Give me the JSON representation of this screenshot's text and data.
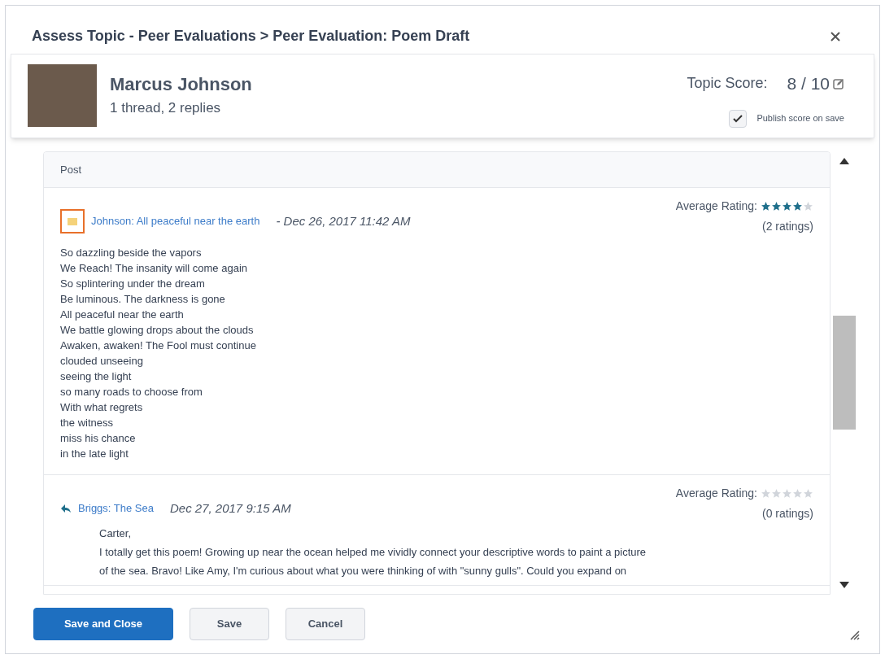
{
  "dialog": {
    "title": "Assess Topic - Peer Evaluations > Peer Evaluation: Poem Draft"
  },
  "user": {
    "name": "Marcus Johnson",
    "summary": "1 thread, 2 replies",
    "score_label": "Topic Score:",
    "score": "8 / 10",
    "publish": {
      "label": "Publish score on save",
      "checked": true
    }
  },
  "table": {
    "column": "Post"
  },
  "posts": [
    {
      "kind": "thread",
      "title": "Johnson: All peaceful near the earth",
      "date": "- Dec 26, 2017 11:42 AM",
      "rating_label": "Average Rating:",
      "stars": 4,
      "ratings": "(2 ratings)",
      "lines": [
        "So dazzling beside the vapors",
        "We Reach! The insanity will come again",
        "So splintering under the dream",
        "Be luminous. The darkness is gone",
        "All peaceful near the earth",
        "We battle glowing drops about the clouds",
        "Awaken, awaken! The Fool must continue",
        "clouded unseeing",
        "seeing the light",
        "so many roads to choose from",
        "With what regrets",
        "the witness",
        "miss his chance",
        "in the late light"
      ]
    },
    {
      "kind": "reply",
      "title": "Briggs: The Sea",
      "date": "Dec 27, 2017 9:15 AM",
      "rating_label": "Average Rating:",
      "stars": 0,
      "ratings": "(0 ratings)",
      "lines": [
        "Carter,",
        "I totally get this poem! Growing up near the ocean helped me vividly connect your descriptive words to paint a picture",
        "of the sea. Bravo! Like Amy, I'm curious about what you were thinking of with \"sunny gulls\". Could you expand on"
      ]
    }
  ],
  "buttons": [
    {
      "label": "Save and Close",
      "kind": "primary"
    },
    {
      "label": "Save",
      "kind": "secondary"
    },
    {
      "label": "Cancel",
      "kind": "secondary"
    }
  ]
}
